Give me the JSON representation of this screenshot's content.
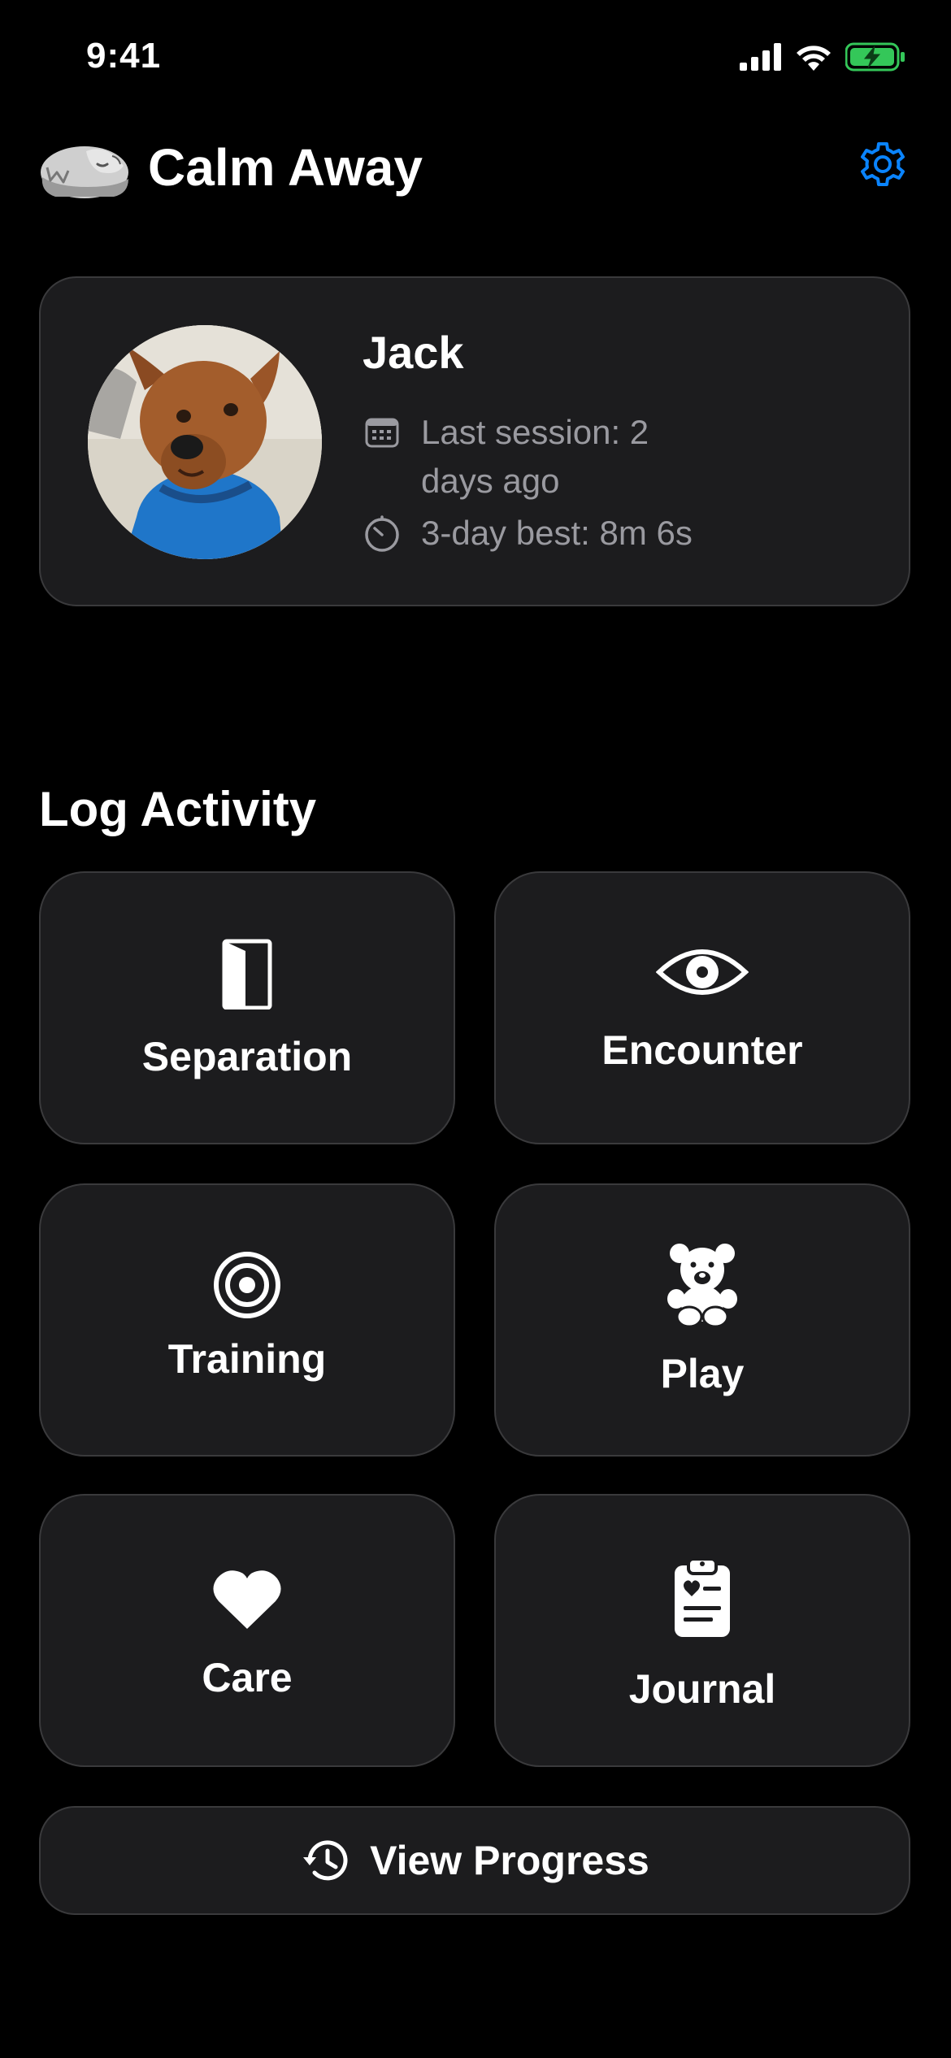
{
  "status_bar": {
    "time": "9:41",
    "signal_icon": "cellular-signal-icon",
    "wifi_icon": "wifi-icon",
    "battery_icon": "battery-charging-icon",
    "battery_color": "#34c759"
  },
  "header": {
    "title": "Calm Away",
    "logo_icon": "sleeping-dog-logo",
    "settings_icon": "gear-icon",
    "settings_color": "#0a84ff"
  },
  "profile": {
    "pet_name": "Jack",
    "avatar_icon": "dog-photo-avatar",
    "last_session": "Last session: 2 days ago",
    "last_session_icon": "calendar-icon",
    "best": "3-day best: 8m 6s",
    "best_icon": "timer-icon"
  },
  "log_activity": {
    "title": "Log Activity",
    "tiles": [
      {
        "label": "Separation",
        "icon": "door-icon"
      },
      {
        "label": "Encounter",
        "icon": "eye-icon"
      },
      {
        "label": "Training",
        "icon": "target-icon"
      },
      {
        "label": "Play",
        "icon": "teddy-bear-icon"
      },
      {
        "label": "Care",
        "icon": "heart-icon"
      },
      {
        "label": "Journal",
        "icon": "clipboard-heart-icon"
      }
    ]
  },
  "progress_button": {
    "label": "View Progress",
    "icon": "history-clock-icon"
  },
  "colors": {
    "background": "#000000",
    "card": "#1c1c1e",
    "card_border": "#3a3a3c",
    "secondary_text": "#9a9aa0",
    "accent": "#0a84ff"
  }
}
